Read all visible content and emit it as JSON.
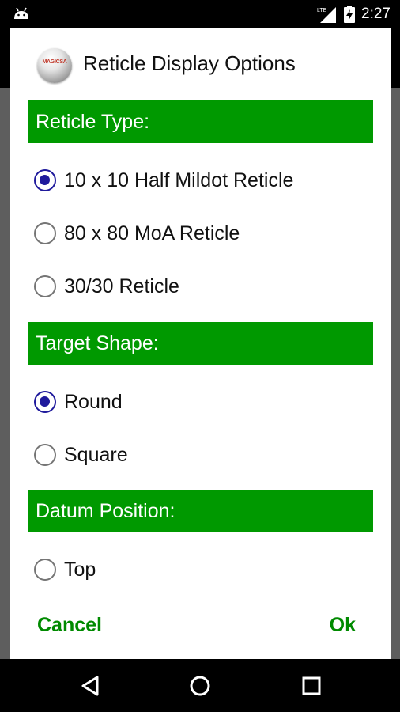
{
  "status_bar": {
    "time": "2:27",
    "network_label": "LTE",
    "icons": [
      "android-icon",
      "lte-signal-icon",
      "battery-charging-icon"
    ]
  },
  "dialog": {
    "logo_text": "MAGICSA",
    "title": "Reticle Display Options",
    "sections": [
      {
        "header": "Reticle Type:",
        "options": [
          {
            "label": "10 x 10 Half Mildot Reticle",
            "checked": true
          },
          {
            "label": "80 x 80 MoA Reticle",
            "checked": false
          },
          {
            "label": "30/30 Reticle",
            "checked": false
          }
        ]
      },
      {
        "header": "Target Shape:",
        "options": [
          {
            "label": "Round",
            "checked": true
          },
          {
            "label": "Square",
            "checked": false
          }
        ]
      },
      {
        "header": "Datum Position:",
        "options": [
          {
            "label": "Top",
            "checked": false
          }
        ]
      }
    ],
    "cancel_label": "Cancel",
    "ok_label": "Ok"
  },
  "colors": {
    "section_header_bg": "#009900",
    "radio_checked": "#1f1a9c",
    "action_text": "#008a00"
  },
  "nav_bar": {
    "icons": [
      "back-icon",
      "home-icon",
      "recents-icon"
    ]
  }
}
